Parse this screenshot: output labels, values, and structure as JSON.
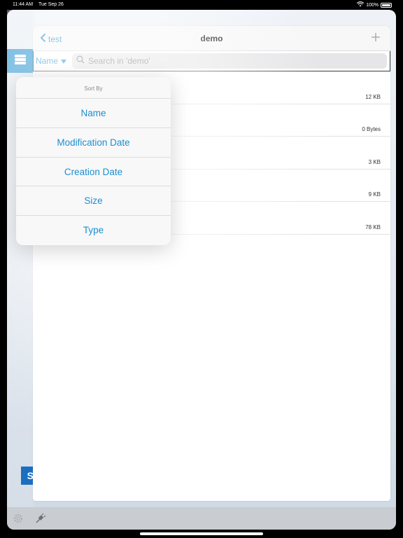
{
  "status_bar": {
    "time": "11:44 AM",
    "date": "Tue Sep 26",
    "battery": "100%"
  },
  "nav": {
    "back_label": "test",
    "title": "demo"
  },
  "toolbar": {
    "sort_label": "Name"
  },
  "search": {
    "placeholder": "Search in 'demo'"
  },
  "files": [
    {
      "size": "12 KB"
    },
    {
      "size": "0 Bytes"
    },
    {
      "size": "3 KB"
    },
    {
      "size": "9 KB"
    },
    {
      "size": "78 KB"
    }
  ],
  "sort_popover": {
    "title": "Sort By",
    "options": [
      "Name",
      "Modification Date",
      "Creation Date",
      "Size",
      "Type"
    ]
  },
  "colors": {
    "accent": "#1b8fd0",
    "rail_button": "#1b8fd0",
    "logo": "#1b6fc0"
  },
  "icons": {
    "back": "chevron-left-icon",
    "add": "plus-icon",
    "search": "magnifier-icon",
    "sort": "triangle-down-icon",
    "storage": "stack-icon",
    "settings": "gear-icon",
    "connection": "plug-icon"
  }
}
